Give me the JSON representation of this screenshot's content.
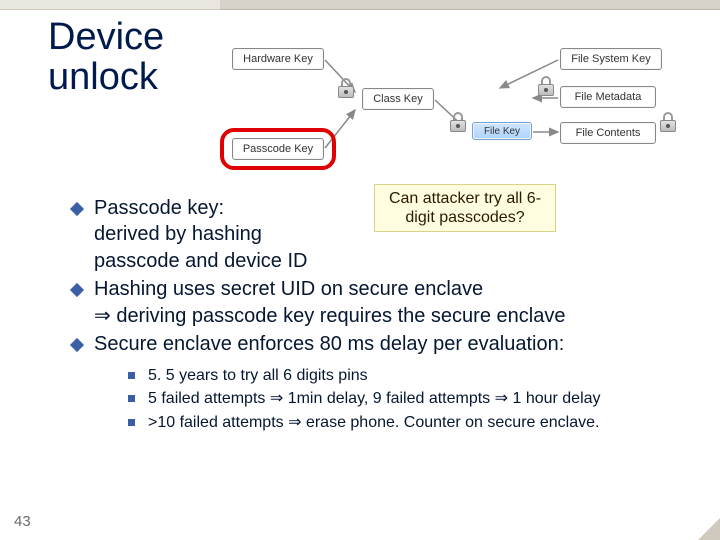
{
  "page_number": "43",
  "title": "Device\nunlock",
  "diagram": {
    "hardware_key": "Hardware Key",
    "passcode_key": "Passcode Key",
    "class_key": "Class Key",
    "file_key": "File Key",
    "file_system_key": "File System Key",
    "file_metadata": "File Metadata",
    "file_contents": "File Contents"
  },
  "callout": "Can attacker try all 6-digit passcodes?",
  "bullets": [
    "Passcode key:",
    "derived by hashing",
    "passcode and device ID",
    "Hashing uses secret UID on secure enclave",
    "⇒  deriving passcode key requires the secure enclave",
    "Secure enclave enforces  80 ms  delay per evaluation:"
  ],
  "subbullets": [
    "5. 5 years to try all 6 digits pins",
    "5 failed attempts ⇒ 1min delay,    9 failed attempts ⇒ 1 hour delay",
    ">10 failed attempts ⇒ erase phone.    Counter on secure enclave."
  ]
}
